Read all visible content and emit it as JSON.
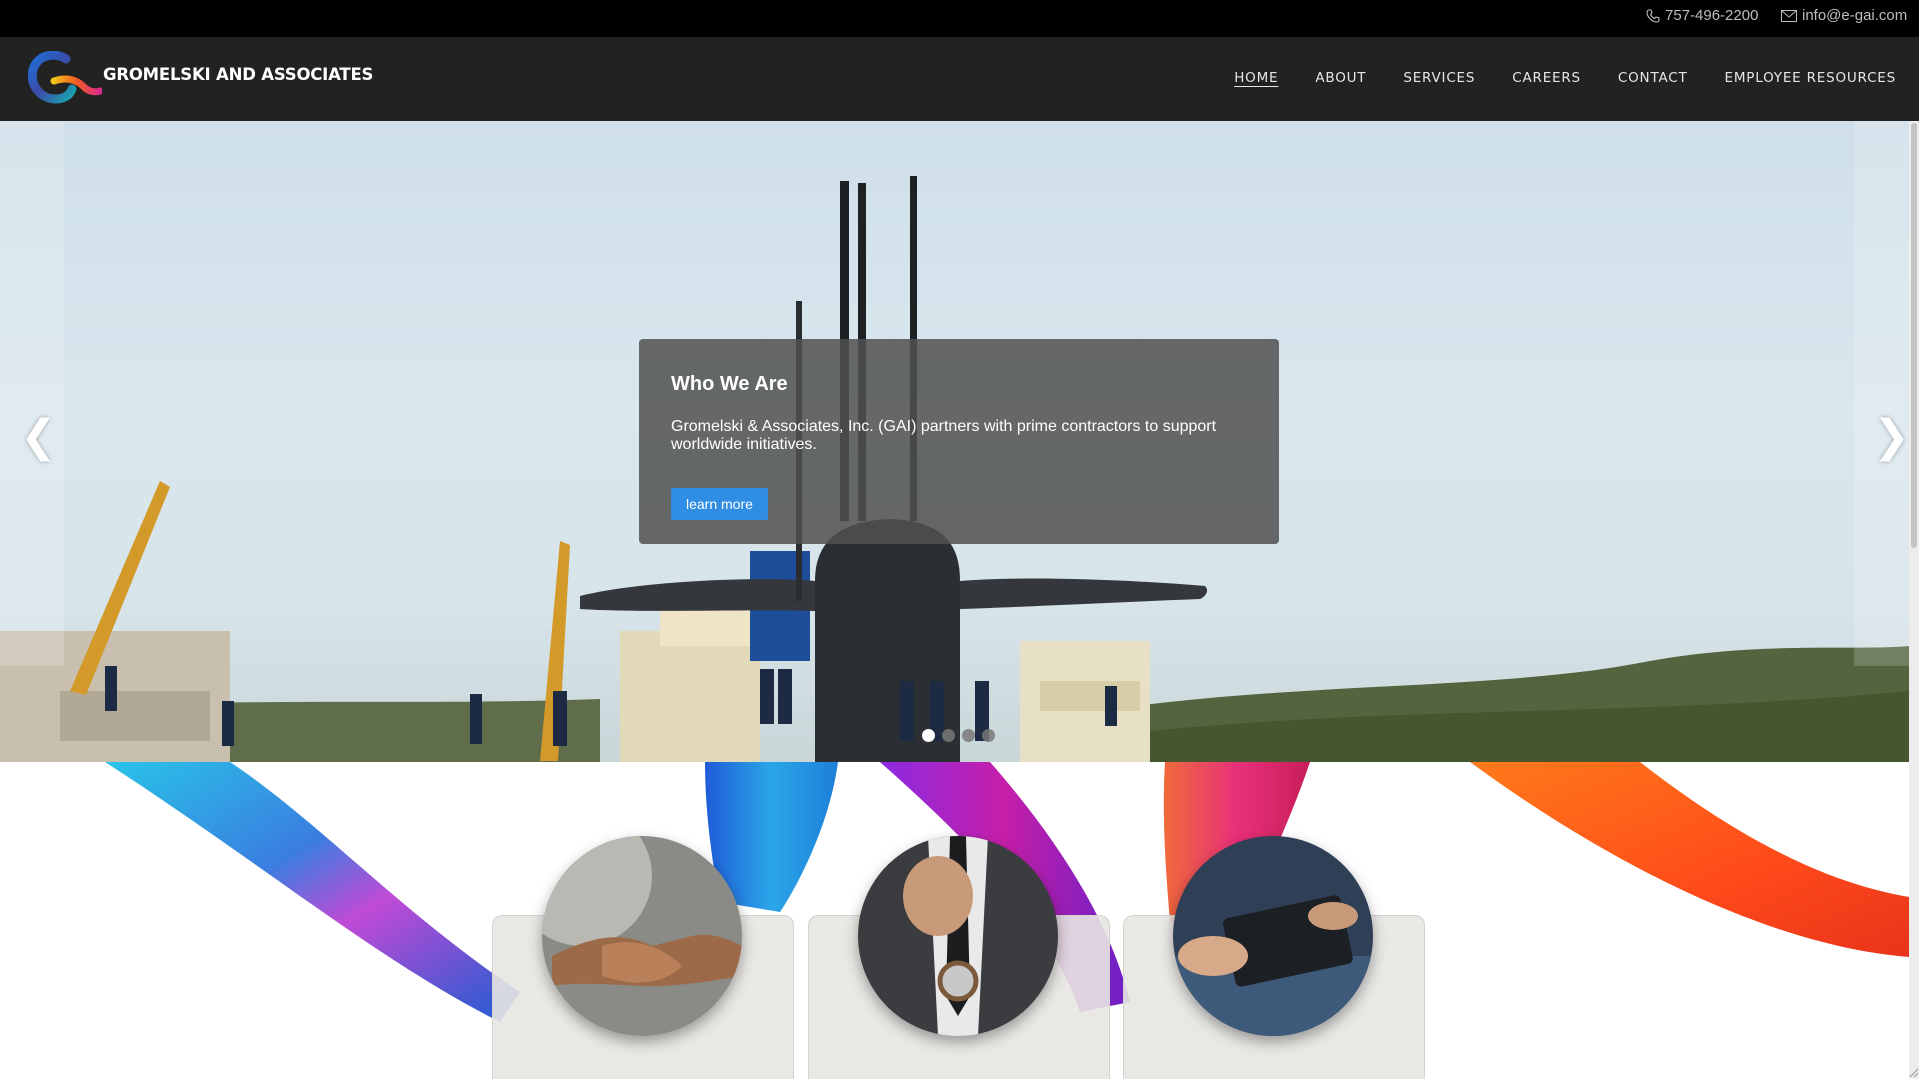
{
  "topbar": {
    "phone": "757-496-2200",
    "email": "info@e-gai.com",
    "phone_icon": "phone-icon",
    "email_icon": "envelope-icon"
  },
  "header": {
    "brand": "GROMELSKI AND ASSOCIATES",
    "nav": [
      {
        "label": "HOME",
        "active": true
      },
      {
        "label": "ABOUT"
      },
      {
        "label": "SERVICES"
      },
      {
        "label": "CAREERS"
      },
      {
        "label": "CONTACT"
      },
      {
        "label": "EMPLOYEE RESOURCES"
      }
    ]
  },
  "hero": {
    "caption_title": "Who We Are",
    "caption_text": "Gromelski & Associates, Inc. (GAI) partners with prime contractors to support worldwide initiatives.",
    "button_label": "learn more",
    "prev_arrow": "❮",
    "next_arrow": "❯",
    "slide_count": 4,
    "active_slide": 1
  },
  "features": {
    "images": [
      "handshake",
      "businessman-adjusting-tie",
      "hands-with-tablet"
    ]
  },
  "colors": {
    "topbar_bg": "#000000",
    "header_bg": "#222222",
    "button_blue": "#2f8ee3",
    "caption_bg": "#505050"
  }
}
